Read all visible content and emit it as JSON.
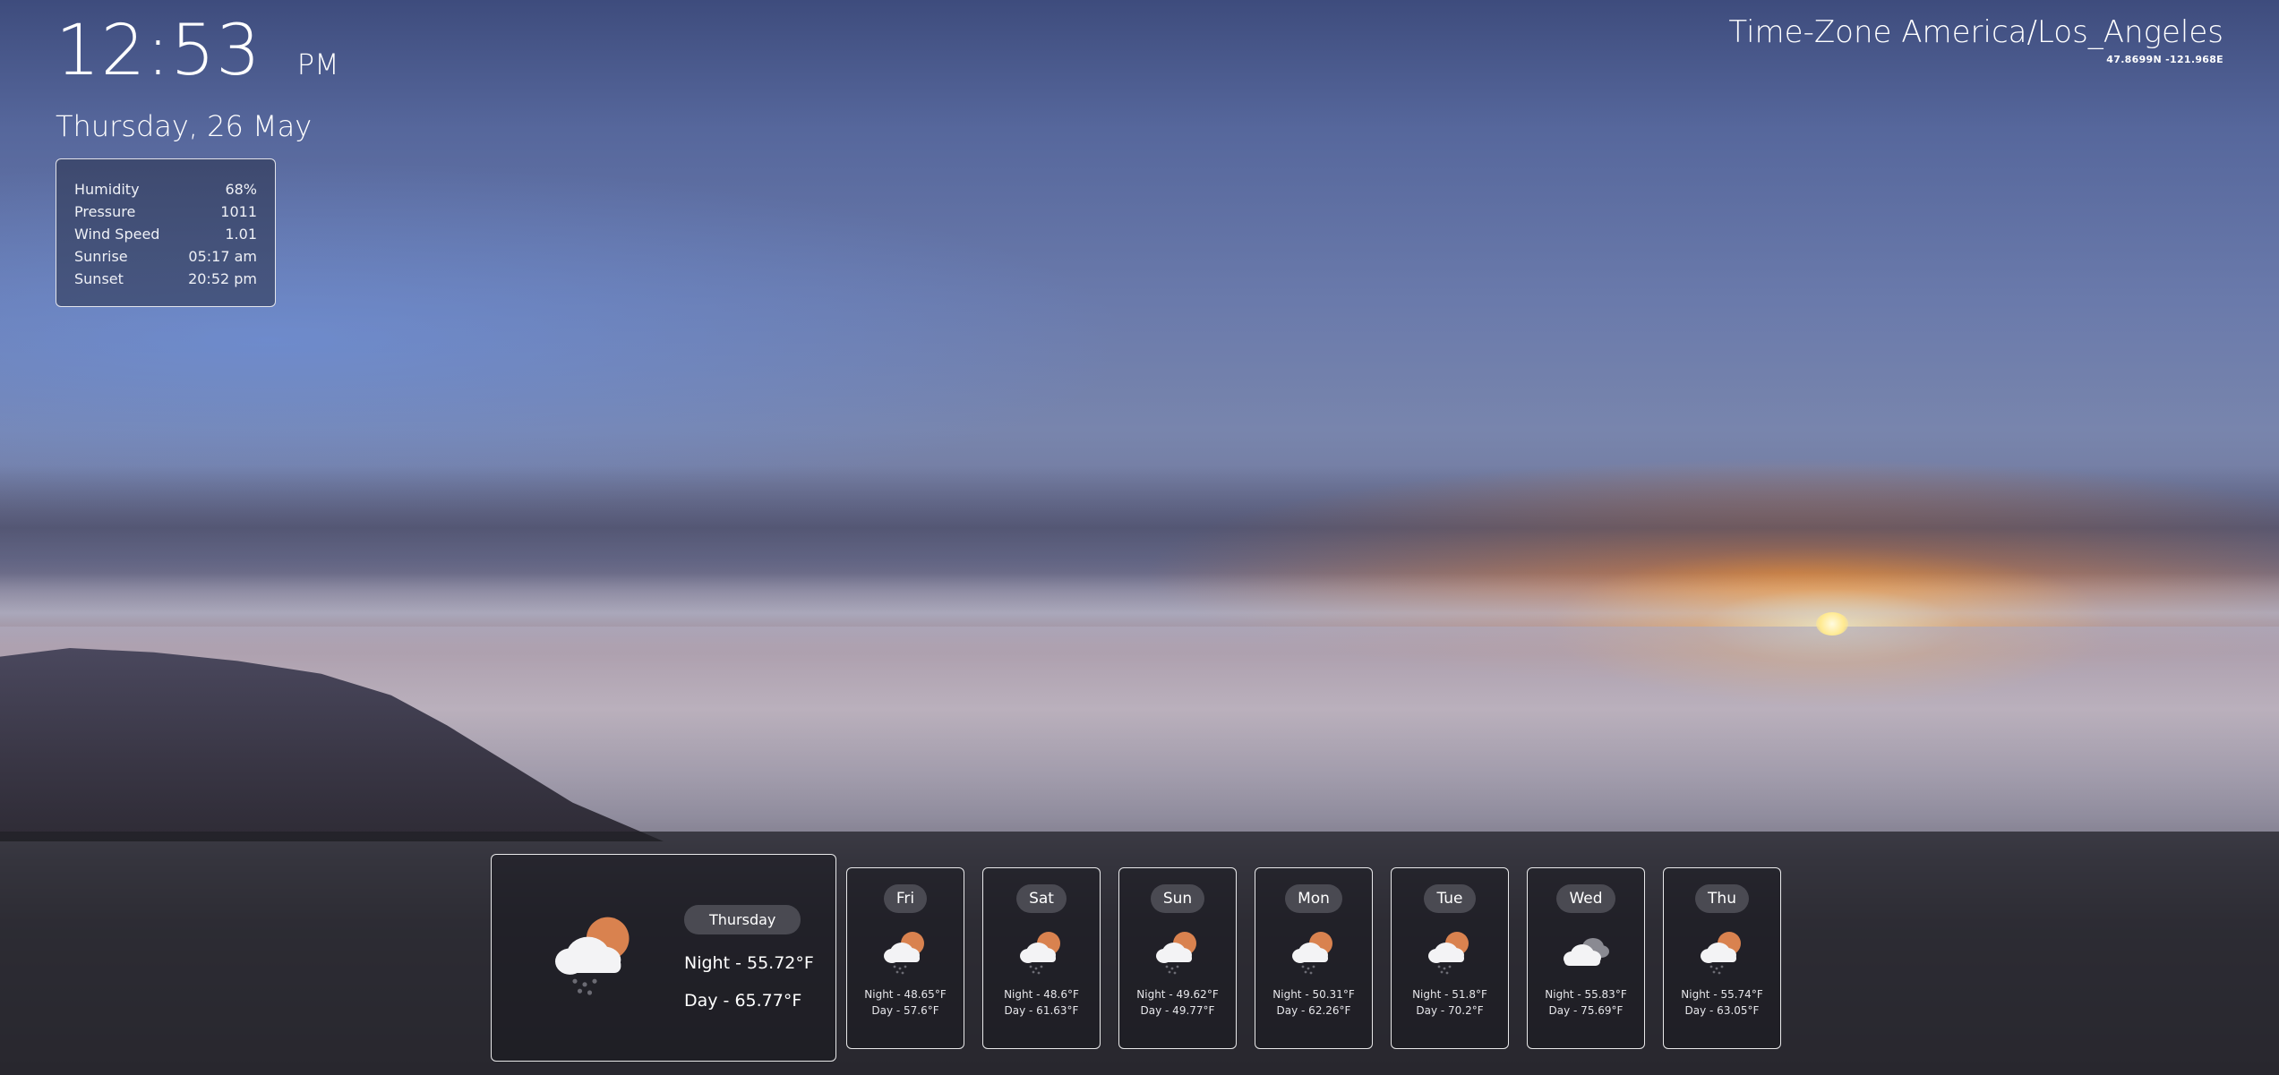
{
  "clock": {
    "time": "12:53",
    "ampm": "PM",
    "date": "Thursday, 26 May"
  },
  "details": [
    {
      "label": "Humidity",
      "value": "68%"
    },
    {
      "label": "Pressure",
      "value": "1011"
    },
    {
      "label": "Wind Speed",
      "value": "1.01"
    },
    {
      "label": "Sunrise",
      "value": "05:17 am"
    },
    {
      "label": "Sunset",
      "value": "20:52 pm"
    }
  ],
  "timezone": {
    "title": "Time-Zone America/Los_Angeles",
    "coords": "47.8699N -121.968E"
  },
  "today": {
    "day": "Thursday",
    "night": "Night - 55.72°F",
    "dayTemp": "Day - 65.77°F",
    "icon": "sun-cloud-rain-icon"
  },
  "forecast": [
    {
      "day": "Fri",
      "night": "Night - 48.65°F",
      "dayTemp": "Day - 57.6°F",
      "icon": "sun-cloud-rain-icon"
    },
    {
      "day": "Sat",
      "night": "Night - 48.6°F",
      "dayTemp": "Day - 61.63°F",
      "icon": "sun-cloud-rain-icon"
    },
    {
      "day": "Sun",
      "night": "Night - 49.62°F",
      "dayTemp": "Day - 49.77°F",
      "icon": "sun-cloud-rain-icon"
    },
    {
      "day": "Mon",
      "night": "Night - 50.31°F",
      "dayTemp": "Day - 62.26°F",
      "icon": "sun-cloud-rain-icon"
    },
    {
      "day": "Tue",
      "night": "Night - 51.8°F",
      "dayTemp": "Day - 70.2°F",
      "icon": "sun-cloud-rain-icon"
    },
    {
      "day": "Wed",
      "night": "Night - 55.83°F",
      "dayTemp": "Day - 75.69°F",
      "icon": "cloudy-icon"
    },
    {
      "day": "Thu",
      "night": "Night - 55.74°F",
      "dayTemp": "Day - 63.05°F",
      "icon": "sun-cloud-rain-icon"
    }
  ],
  "colors": {
    "sun": "#d9824f",
    "cloud": "#f3f3f5",
    "dark_cloud": "#8a8a92",
    "pill": "#4a4a52"
  }
}
